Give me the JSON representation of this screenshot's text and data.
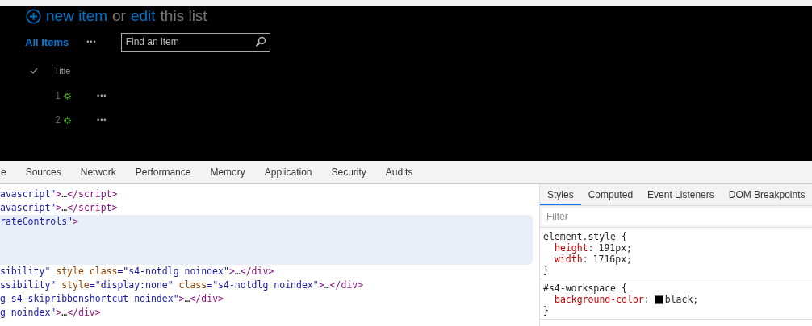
{
  "list_header": {
    "heading": [
      {
        "kind": "link",
        "text": "new item"
      },
      {
        "kind": "plain",
        "text": "or"
      },
      {
        "kind": "link",
        "text": "edit"
      },
      {
        "kind": "plain",
        "text": "this list"
      }
    ],
    "view": {
      "label": "All Items",
      "selected": true
    },
    "view_menu": "•••",
    "search": {
      "placeholder": "Find an item"
    },
    "columns": [
      "Title"
    ],
    "rows": [
      {
        "title": "1",
        "menu": "•••"
      },
      {
        "title": "2",
        "menu": "•••"
      }
    ]
  },
  "devtools": {
    "tabs": [
      {
        "label": "e",
        "selected": false
      },
      {
        "label": "Sources",
        "selected": false
      },
      {
        "label": "Network",
        "selected": false
      },
      {
        "label": "Performance",
        "selected": false
      },
      {
        "label": "Memory",
        "selected": false
      },
      {
        "label": "Application",
        "selected": false
      },
      {
        "label": "Security",
        "selected": false
      },
      {
        "label": "Audits",
        "selected": false
      }
    ],
    "code_lines": [
      {
        "selected": false,
        "tokens": [
          {
            "kind": "value",
            "text": "avascript\""
          },
          {
            "kind": "tag",
            "text": ">"
          },
          {
            "kind": "text",
            "text": "…"
          },
          {
            "kind": "tag",
            "text": "</script>"
          }
        ]
      },
      {
        "selected": false,
        "tokens": [
          {
            "kind": "value",
            "text": "avascript\""
          },
          {
            "kind": "tag",
            "text": ">"
          },
          {
            "kind": "text",
            "text": "…"
          },
          {
            "kind": "tag",
            "text": "</script>"
          }
        ]
      },
      {
        "selected": true,
        "tokens": [
          {
            "kind": "value",
            "text": "rateControls\""
          },
          {
            "kind": "tag",
            "text": ">"
          }
        ]
      },
      {
        "selected": false,
        "tokens": [
          {
            "kind": "value",
            "text": "sibility\""
          },
          {
            "kind": "attr",
            "text": " style"
          },
          {
            "kind": "attr",
            "text": " class"
          },
          {
            "kind": "value",
            "text": "=\"s4-notdlg noindex\""
          },
          {
            "kind": "tag",
            "text": ">"
          },
          {
            "kind": "text",
            "text": "…"
          },
          {
            "kind": "tag",
            "text": "</div>"
          }
        ]
      },
      {
        "selected": false,
        "tokens": [
          {
            "kind": "value",
            "text": "ssibility\""
          },
          {
            "kind": "attr",
            "text": " style"
          },
          {
            "kind": "value",
            "text": "=\"display:none\""
          },
          {
            "kind": "attr",
            "text": " class"
          },
          {
            "kind": "value",
            "text": "=\"s4-notdlg noindex\""
          },
          {
            "kind": "tag",
            "text": ">"
          },
          {
            "kind": "text",
            "text": "…"
          },
          {
            "kind": "tag",
            "text": "</div>"
          }
        ]
      },
      {
        "selected": false,
        "tokens": [
          {
            "kind": "value",
            "text": "g s4-skipribbonshortcut noindex\""
          },
          {
            "kind": "tag",
            "text": ">"
          },
          {
            "kind": "text",
            "text": "…"
          },
          {
            "kind": "tag",
            "text": "</div>"
          }
        ]
      },
      {
        "selected": false,
        "tokens": [
          {
            "kind": "value",
            "text": "g noindex\""
          },
          {
            "kind": "tag",
            "text": ">"
          },
          {
            "kind": "text",
            "text": "…"
          },
          {
            "kind": "tag",
            "text": "</div>"
          }
        ]
      }
    ],
    "styles_tabs": [
      {
        "label": "Styles",
        "selected": true
      },
      {
        "label": "Computed",
        "selected": false
      },
      {
        "label": "Event Listeners",
        "selected": false
      },
      {
        "label": "DOM Breakpoints",
        "selected": false
      }
    ],
    "filter": {
      "placeholder": "Filter"
    },
    "rules": [
      {
        "selector": "element.style {",
        "properties": [
          {
            "kind": "plain",
            "name": "height",
            "colon": ":",
            "value": "191px;"
          },
          {
            "kind": "plain",
            "name": "width",
            "colon": ":",
            "value": "1716px;"
          }
        ],
        "close": "}"
      },
      {
        "selector": "#s4-workspace {",
        "properties": [
          {
            "kind": "color",
            "name": "background-color",
            "colon": ":",
            "value": "black;"
          }
        ],
        "close": "}"
      }
    ]
  }
}
